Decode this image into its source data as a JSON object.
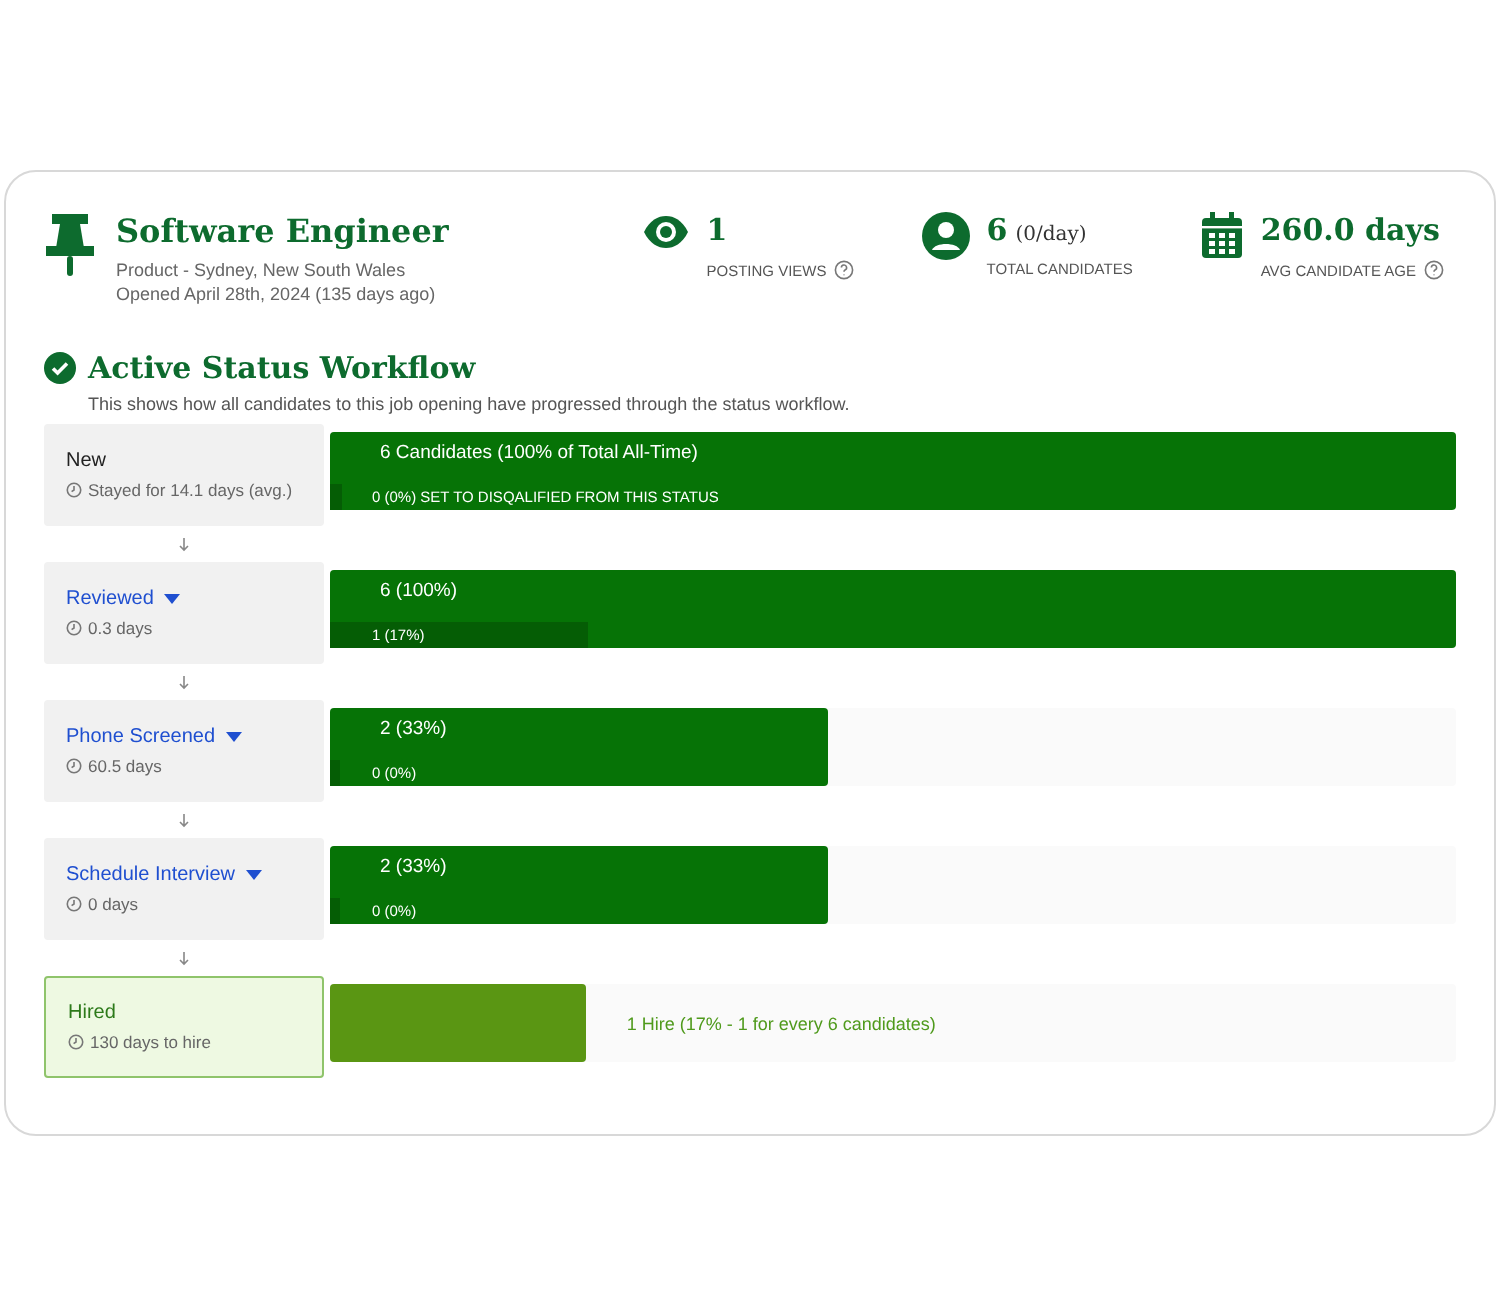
{
  "job": {
    "title": "Software Engineer",
    "location": "Product - Sydney, New South Wales",
    "opened": "Opened April 28th, 2024 (135 days ago)"
  },
  "stats": [
    {
      "kind": "views",
      "value": "1",
      "label": "POSTING VIEWS",
      "help": true
    },
    {
      "kind": "candidates",
      "value": "6",
      "suffix": "(0/day)",
      "label": "TOTAL CANDIDATES",
      "help": false
    },
    {
      "kind": "age",
      "value": "260.0 days",
      "label": "AVG CANDIDATE AGE",
      "help": true
    }
  ],
  "workflow": {
    "title": "Active Status Workflow",
    "description": "This shows how all candidates to this job opening have progressed through the status workflow.",
    "stages": [
      {
        "kind": "start",
        "name": "New",
        "time": "Stayed for 14.1 days (avg.)",
        "level": 1,
        "count": "6 Candidates (100% of Total All-Time)",
        "disqualified": {
          "text": "0 (0%) SET TO DISQALIFIED FROM THIS STATUS",
          "level": 0.01
        }
      },
      {
        "kind": "status",
        "name": "Reviewed",
        "time": "0.3 days",
        "level": 1,
        "count": "6 (100%)",
        "disqualified": {
          "text": "1 (17%)",
          "level": 0.23
        }
      },
      {
        "kind": "status",
        "name": "Phone Screened",
        "time": "60.5 days",
        "level": 0.443,
        "count": "2 (33%)",
        "disqualified": {
          "text": "0 (0%)",
          "level": 0.02
        }
      },
      {
        "kind": "status",
        "name": "Schedule Interview",
        "time": "0 days",
        "level": 0.443,
        "count": "2 (33%)",
        "disqualified": {
          "text": "0 (0%)",
          "level": 0.02
        }
      },
      {
        "kind": "final",
        "name": "Hired",
        "time": "130 days to hire",
        "level": 0.228,
        "summary": "1 Hire (17% - 1 for every 6 candidates)"
      }
    ]
  }
}
